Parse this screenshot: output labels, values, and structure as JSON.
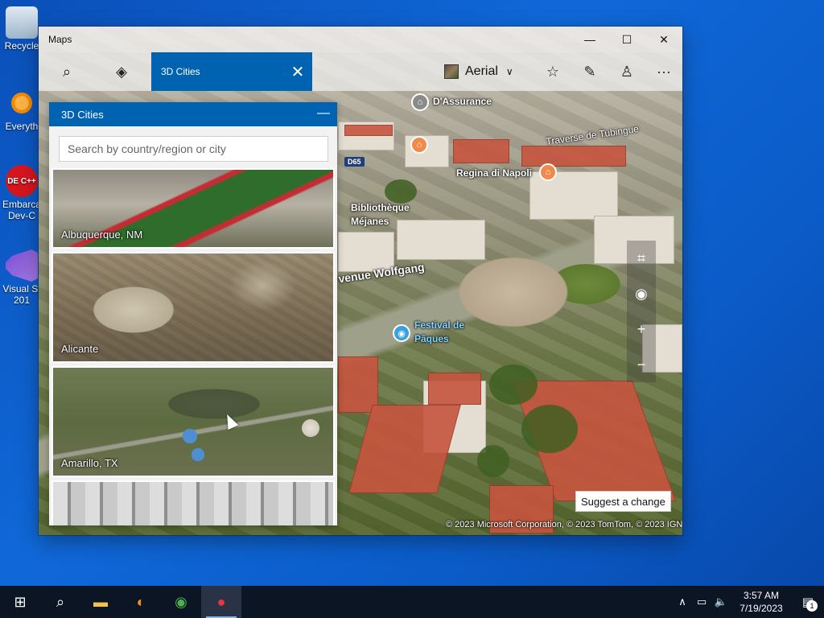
{
  "desktop": {
    "icons": [
      {
        "label": "Recycle"
      },
      {
        "label": "Everyth"
      },
      {
        "label": "Embarca"
      },
      {
        "label": "Dev-C"
      },
      {
        "label": "Visual St"
      },
      {
        "label": "201"
      }
    ],
    "icon_badges": {
      "dev_badge": "DE C++"
    }
  },
  "window": {
    "title": "Maps",
    "minimize": "—",
    "maximize": "☐",
    "close": "✕"
  },
  "toolbar": {
    "search_icon": "⌕",
    "directions_icon": "◈",
    "tab_label": "3D Cities",
    "tab_close": "✕",
    "map_style": "Aerial",
    "chevron": "∨",
    "favorites_icon": "☆",
    "ink_icon": "✎",
    "account_icon": "♙",
    "more_icon": "···"
  },
  "panel": {
    "title": "3D Cities",
    "minimize": "—",
    "search_placeholder": "Search by country/region or city",
    "cities": [
      {
        "name": "Albuquerque, NM"
      },
      {
        "name": "Alicante"
      },
      {
        "name": "Amarillo, TX"
      },
      {
        "name": ""
      }
    ]
  },
  "map": {
    "labels": {
      "assurance": "D'Assurance",
      "road": "D65",
      "bibliotheque": "Bibliothèque",
      "mejanes": "Méjanes",
      "regina": "Regina di Napoli",
      "avenue": "venue Wolfgang",
      "festival": "Festival de",
      "paques": "Pâques",
      "traverse": "Traverse de Tubingue"
    },
    "controls": {
      "tilt": "⌗",
      "locate": "◉",
      "zoom_in": "+",
      "zoom_out": "−"
    },
    "suggest": "Suggest a change",
    "copyright": "© 2023 Microsoft Corporation, © 2023 TomTom, © 2023 IGN"
  },
  "taskbar": {
    "start_icon": "⊞",
    "search_icon": "⌕",
    "explorer_icon": "▬",
    "firefox_icon": "◐",
    "chrome_icon": "◉",
    "maps_icon": "●",
    "tray": {
      "chevron": "∧",
      "network": "▭",
      "volume": "🔈"
    },
    "time": "3:57 AM",
    "date": "7/19/2023",
    "notification_icon": "▤",
    "notification_count": "1"
  },
  "colors": {
    "accent": "#0063b1",
    "desktop": "#0b5cc9",
    "taskbar": "#0c1524"
  }
}
